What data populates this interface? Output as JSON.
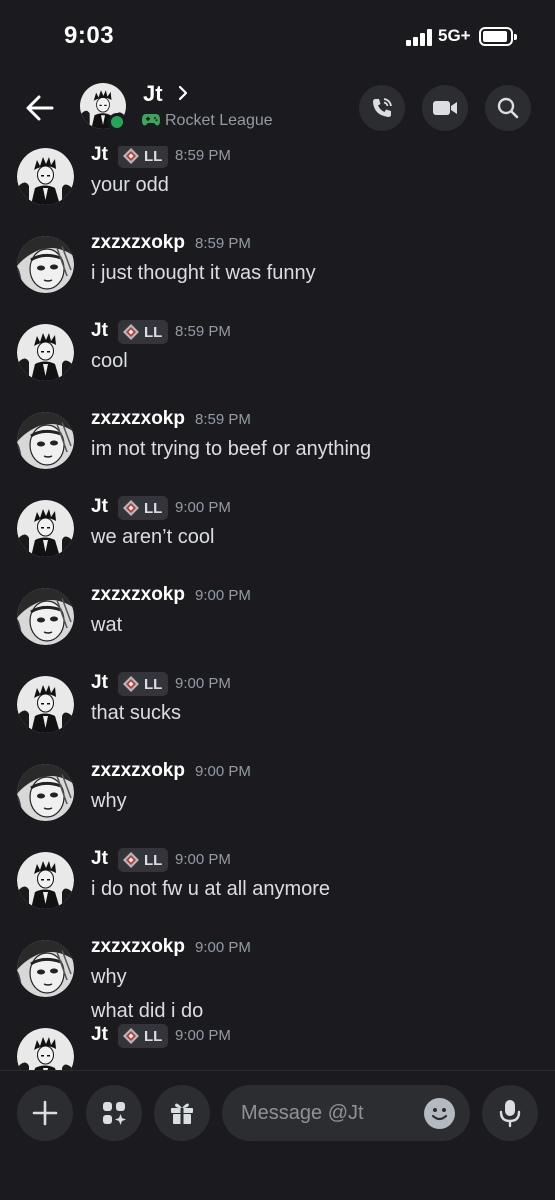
{
  "status_bar": {
    "time": "9:03",
    "network": "5G+"
  },
  "header": {
    "name": "Jt",
    "activity": "Rocket League",
    "colors": {
      "online": "#23a55a",
      "background": "#1b1b1f"
    }
  },
  "messages": [
    {
      "author": "Jt",
      "tag": "LL",
      "time": "8:59 PM",
      "lines": [
        "your odd"
      ]
    },
    {
      "author": "zxzxzxokp",
      "tag": "",
      "time": "8:59 PM",
      "lines": [
        "i just thought it was funny"
      ]
    },
    {
      "author": "Jt",
      "tag": "LL",
      "time": "8:59 PM",
      "lines": [
        "cool"
      ]
    },
    {
      "author": "zxzxzxokp",
      "tag": "",
      "time": "8:59 PM",
      "lines": [
        "im not trying to beef or anything"
      ]
    },
    {
      "author": "Jt",
      "tag": "LL",
      "time": "9:00 PM",
      "lines": [
        "we aren’t cool"
      ]
    },
    {
      "author": "zxzxzxokp",
      "tag": "",
      "time": "9:00 PM",
      "lines": [
        "wat"
      ]
    },
    {
      "author": "Jt",
      "tag": "LL",
      "time": "9:00 PM",
      "lines": [
        "that sucks"
      ]
    },
    {
      "author": "zxzxzxokp",
      "tag": "",
      "time": "9:00 PM",
      "lines": [
        "why"
      ]
    },
    {
      "author": "Jt",
      "tag": "LL",
      "time": "9:00 PM",
      "lines": [
        "i do not fw u at all anymore"
      ]
    },
    {
      "author": "zxzxzxokp",
      "tag": "",
      "time": "9:00 PM",
      "lines": [
        "why",
        "what did i do"
      ]
    },
    {
      "author": "Jt",
      "tag": "LL",
      "time": "9:00 PM",
      "lines": []
    }
  ],
  "composer": {
    "placeholder": "Message @Jt"
  },
  "icons": {
    "back": "arrow-left-icon",
    "call": "phone-icon",
    "video": "video-camera-icon",
    "search": "search-icon",
    "add": "plus-icon",
    "apps": "apps-icon",
    "gift": "gift-icon",
    "emoji": "emoji-icon",
    "mic": "microphone-icon",
    "game": "gamepad-icon",
    "tag": "diamond-badge-icon"
  }
}
